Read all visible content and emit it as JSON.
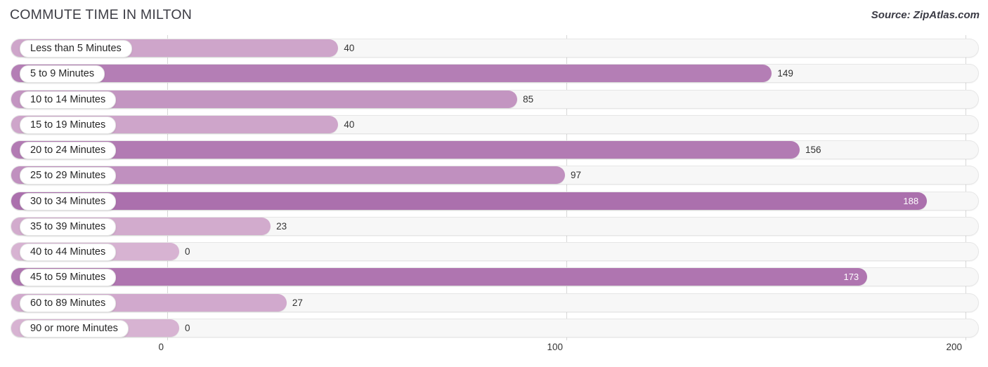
{
  "header": {
    "title": "COMMUTE TIME IN MILTON",
    "source": "Source: ZipAtlas.com"
  },
  "axis": {
    "ticks": [
      {
        "label": "0",
        "value": 0
      },
      {
        "label": "100",
        "value": 100
      },
      {
        "label": "200",
        "value": 200
      }
    ],
    "min": 0,
    "max": 200
  },
  "colors": {
    "bar_low": "#d7b3d2",
    "bar_high": "#ab70ad",
    "track": "#f7f7f7",
    "track_border": "#e6e6e6",
    "gridline": "#d8d8d8",
    "label_text": "#272727",
    "value_text_inside": "#ffffff",
    "value_text_outside": "#333333"
  },
  "chart_data": {
    "type": "bar",
    "orientation": "horizontal",
    "title": "COMMUTE TIME IN MILTON",
    "xlabel": "",
    "ylabel": "",
    "xlim": [
      0,
      200
    ],
    "grid": true,
    "legend": false,
    "categories": [
      "Less than 5 Minutes",
      "5 to 9 Minutes",
      "10 to 14 Minutes",
      "15 to 19 Minutes",
      "20 to 24 Minutes",
      "25 to 29 Minutes",
      "30 to 34 Minutes",
      "35 to 39 Minutes",
      "40 to 44 Minutes",
      "45 to 59 Minutes",
      "60 to 89 Minutes",
      "90 or more Minutes"
    ],
    "values": [
      40,
      149,
      85,
      40,
      156,
      97,
      188,
      23,
      0,
      173,
      27,
      0
    ],
    "value_labels": [
      "40",
      "149",
      "85",
      "40",
      "156",
      "97",
      "188",
      "23",
      "0",
      "173",
      "27",
      "0"
    ]
  }
}
